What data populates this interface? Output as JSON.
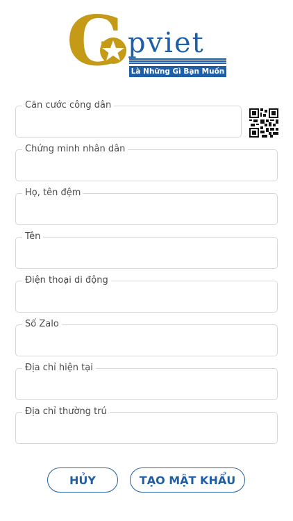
{
  "logo": {
    "letter": "G",
    "brand": "pviet",
    "tagline": "Là Những Gì Bạn Muốn",
    "colors": {
      "gold": "#c49a16",
      "blue": "#1f5fa8"
    }
  },
  "form": {
    "fields": [
      {
        "label": "Căn cước công dân",
        "value": ""
      },
      {
        "label": "Chứng minh nhân dân",
        "value": ""
      },
      {
        "label": "Họ, tên đệm",
        "value": ""
      },
      {
        "label": "Tên",
        "value": ""
      },
      {
        "label": "Điện thoại di động",
        "value": ""
      },
      {
        "label": "Số Zalo",
        "value": ""
      },
      {
        "label": "Địa chỉ hiện tại",
        "value": ""
      },
      {
        "label": "Địa chỉ thường trú",
        "value": ""
      }
    ],
    "qr_icon": "qr-code-icon"
  },
  "actions": {
    "cancel_label": "HỦY",
    "create_label": "TẠO MẬT KHẨU"
  },
  "colors": {
    "accent": "#1f5fa8",
    "border": "#d7d7d7"
  }
}
